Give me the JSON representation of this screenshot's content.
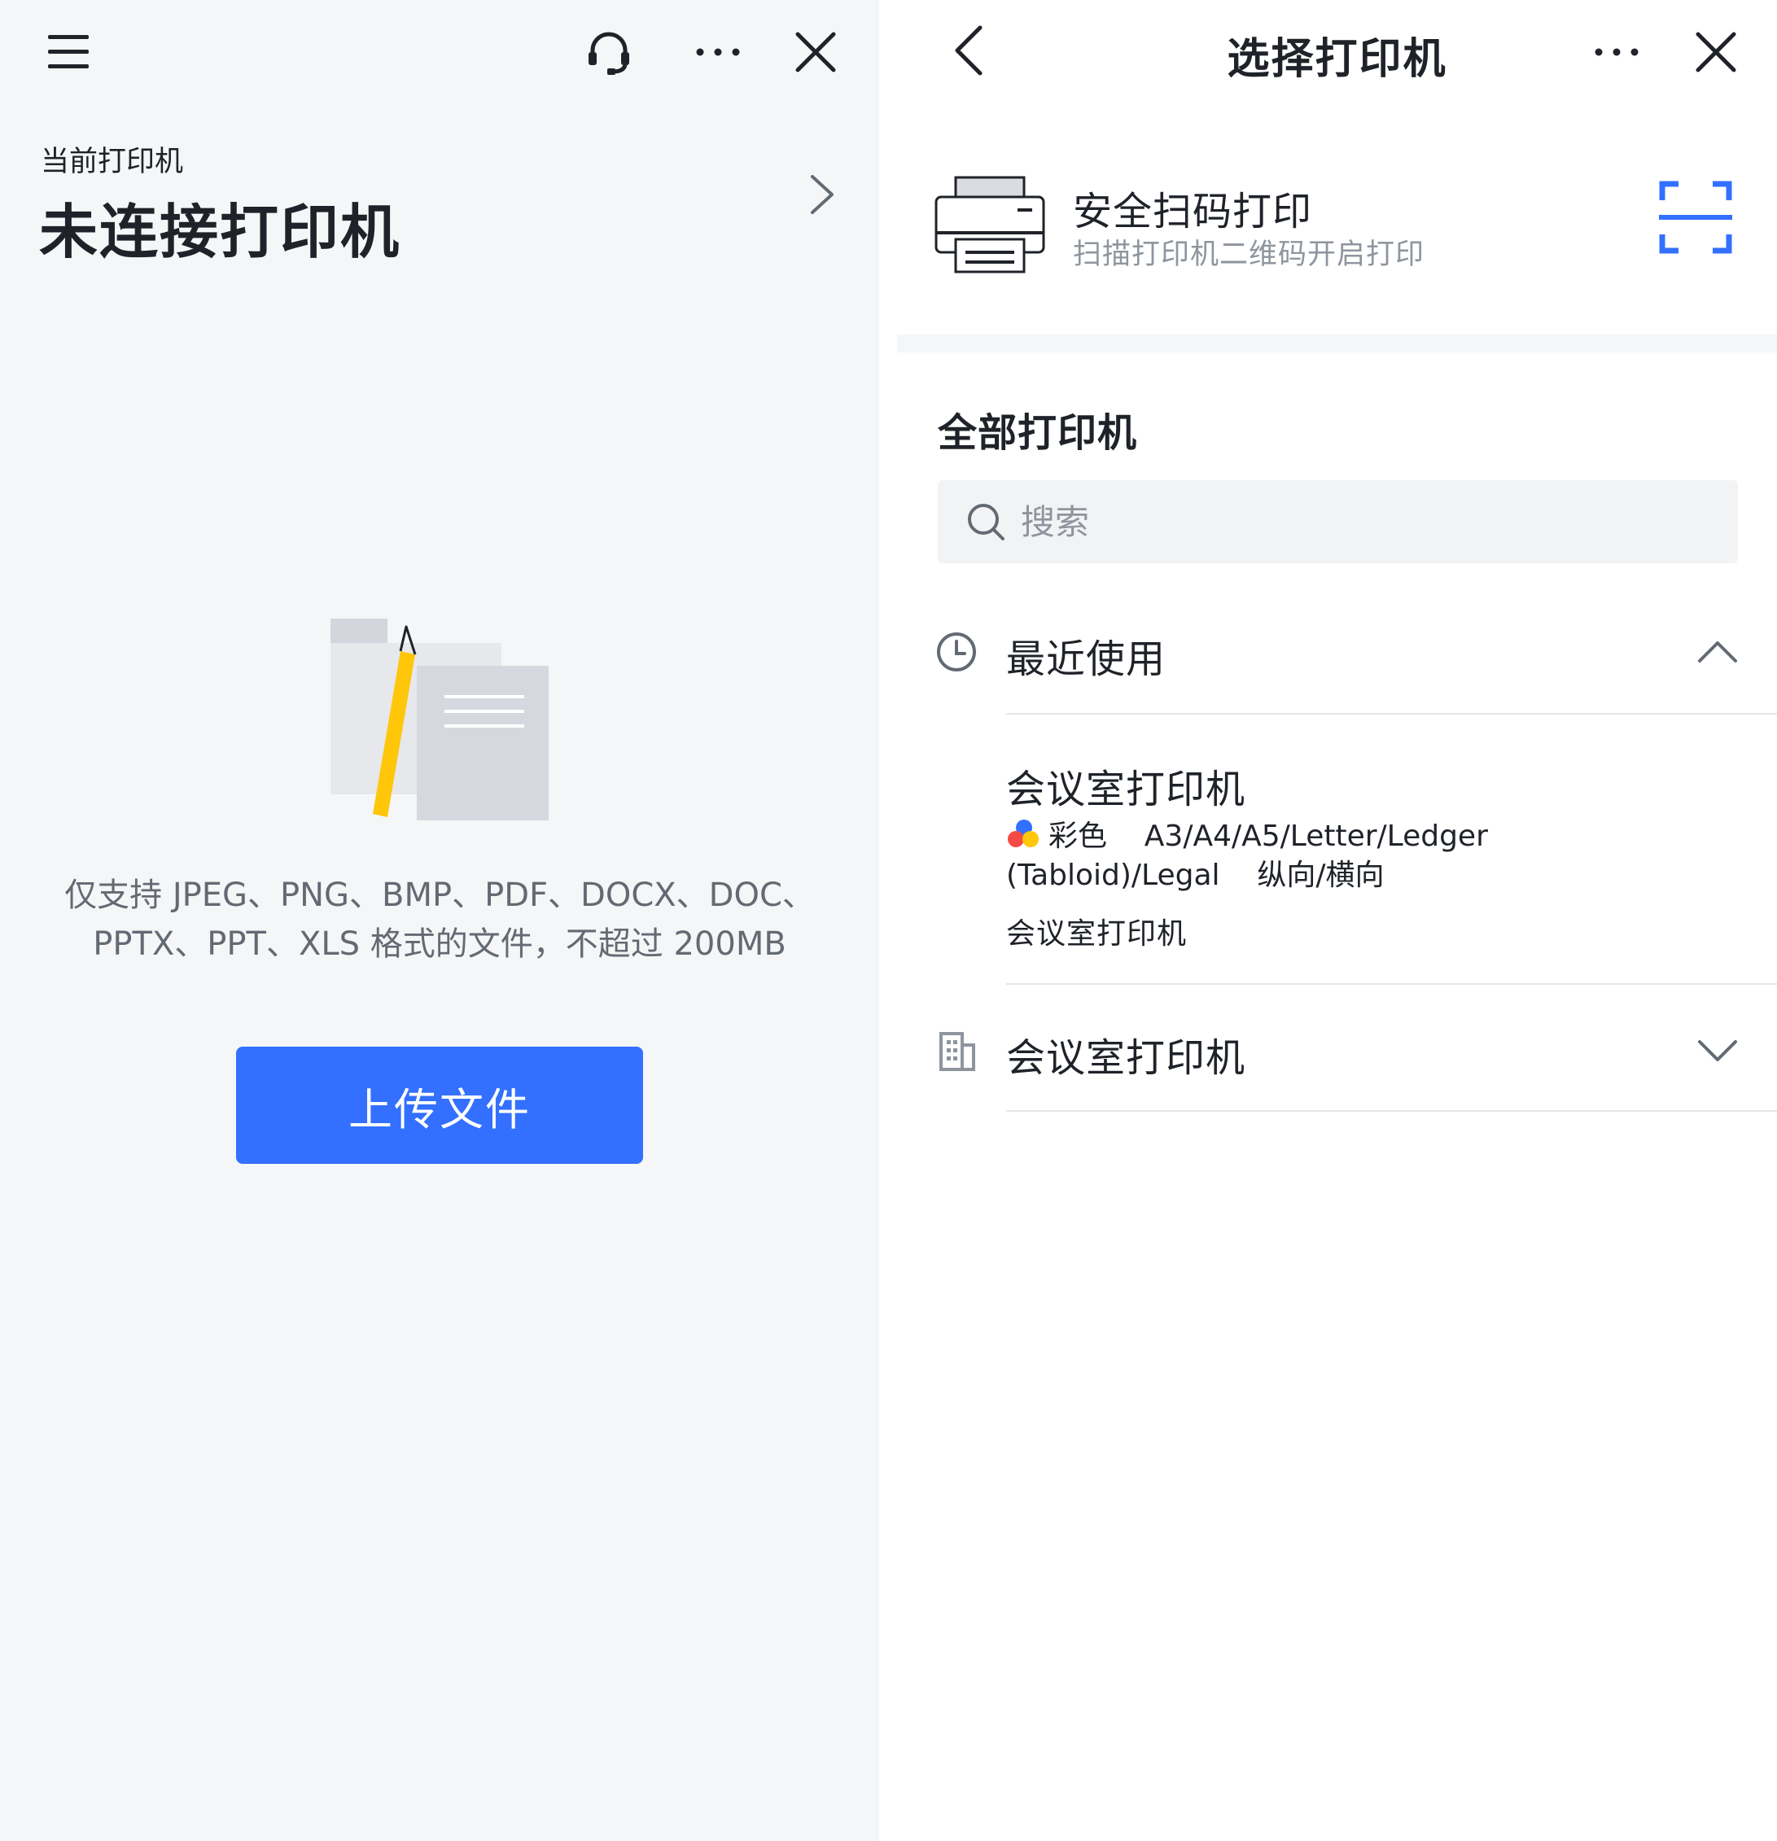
{
  "left_panel": {
    "current_printer_label": "当前打印机",
    "printer_status": "未连接打印机",
    "support_text_line1": "仅支持 JPEG、PNG、BMP、PDF、DOCX、DOC、",
    "support_text_line2": "PPTX、PPT、XLS 格式的文件，不超过 200MB",
    "upload_button_label": "上传文件",
    "icons": [
      "menu-icon",
      "headset-icon",
      "more-icon",
      "close-icon",
      "chevron-right-icon"
    ]
  },
  "right_panel": {
    "title": "选择打印机",
    "scan_print": {
      "title": "安全扫码打印",
      "subtitle": "扫描打印机二维码开启打印"
    },
    "all_printers_label": "全部打印机",
    "search": {
      "placeholder": "搜索",
      "value": ""
    },
    "recent_group": {
      "label": "最近使用",
      "expanded": true
    },
    "recent_printer": {
      "name": "会议室打印机",
      "color_mode": "彩色",
      "paper_sizes": "A3/A4/A5/Letter/Ledger",
      "paper_sizes_cont": "(Tabloid)/Legal",
      "orientation": "纵向/横向",
      "location": "会议室打印机"
    },
    "location_group": {
      "label": "会议室打印机",
      "expanded": false
    },
    "icons": [
      "back-icon",
      "more-icon",
      "close-icon",
      "printer-icon",
      "scan-icon",
      "search-icon",
      "clock-icon",
      "building-icon",
      "chevron-up-icon",
      "chevron-down-icon"
    ]
  },
  "colors": {
    "accent": "#3370ff",
    "text_primary": "#1f2329",
    "text_secondary": "#8f959e",
    "panel_bg": "#f5f6f7",
    "pencil": "#ffc60a",
    "dot_blue": "#3370ff",
    "dot_red": "#f54a45",
    "dot_yellow": "#ffc60a"
  }
}
